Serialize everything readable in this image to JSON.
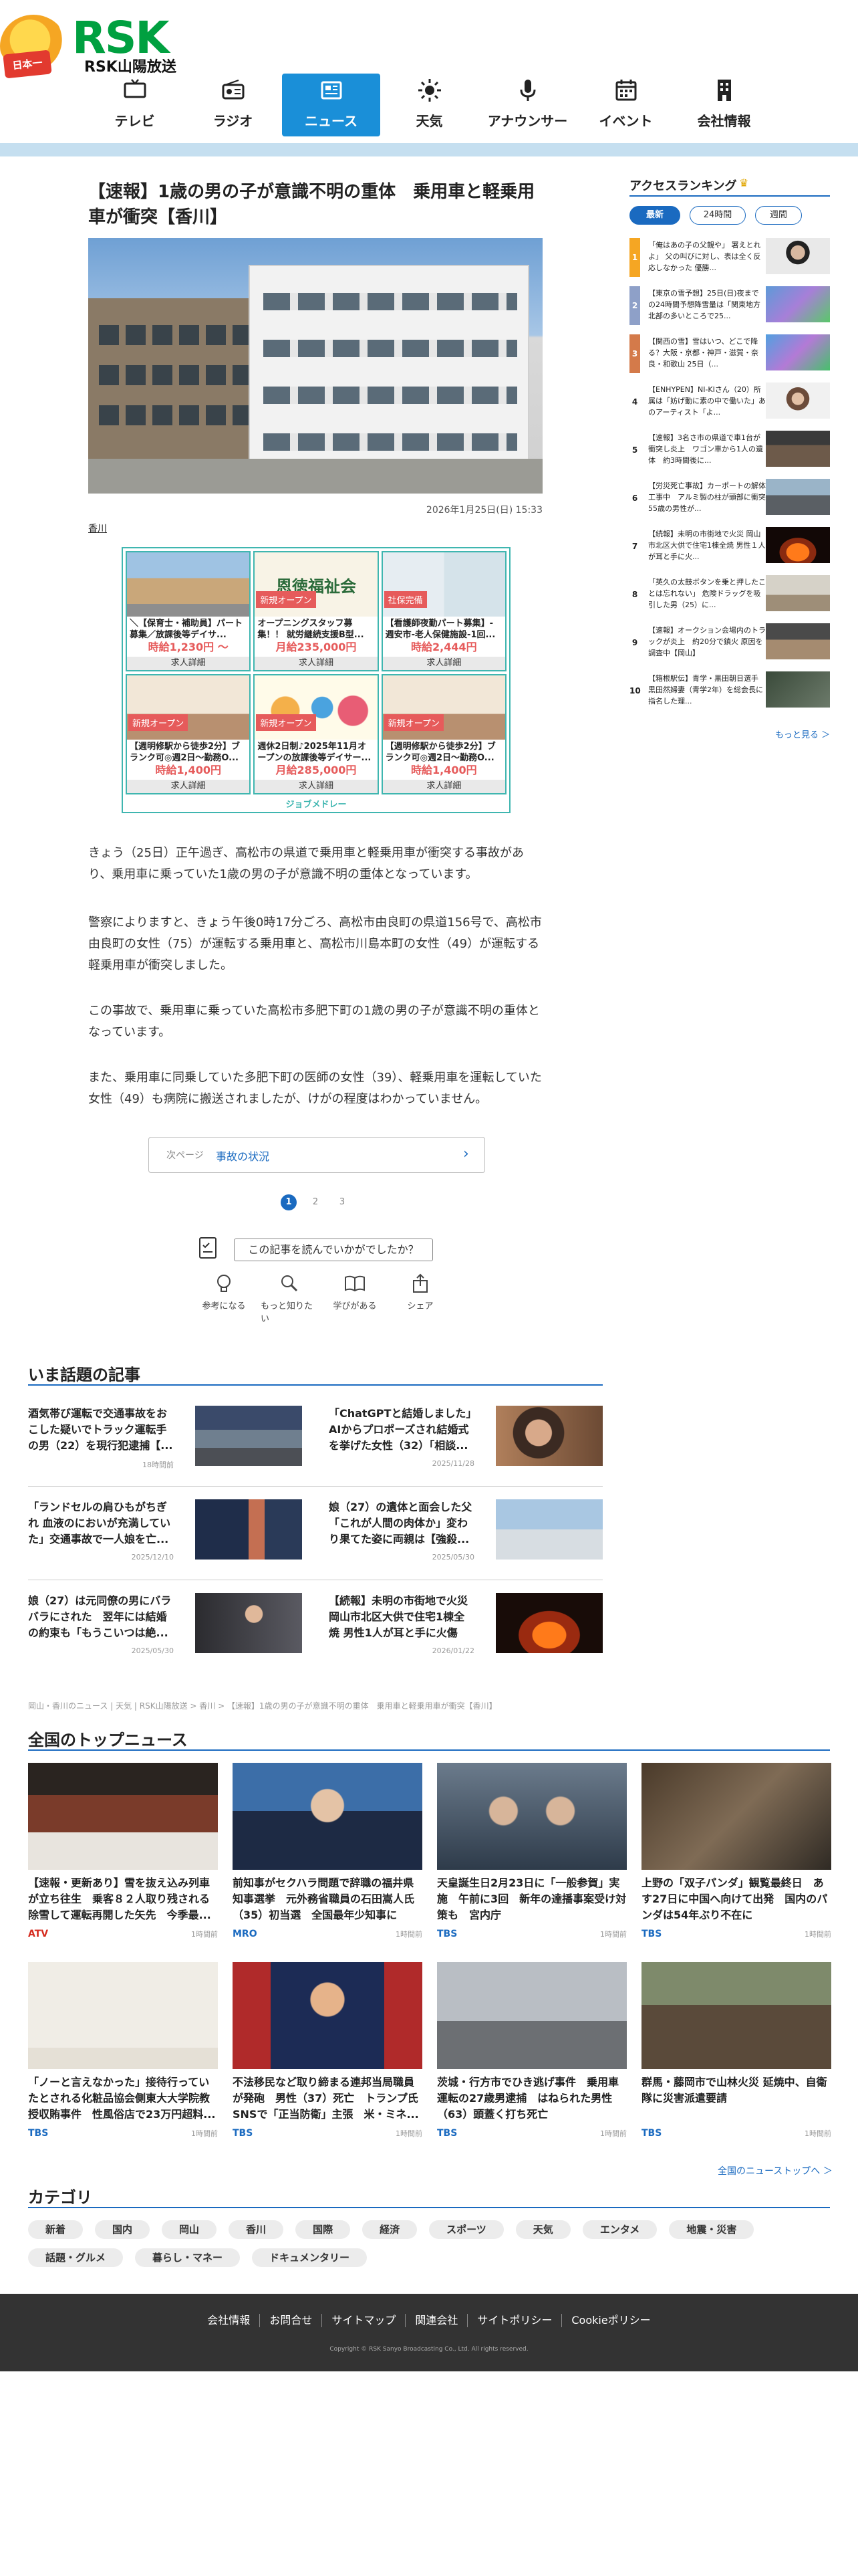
{
  "site": {
    "logo_text": "RSK",
    "logo_sub": "RSK山陽放送",
    "mascot_badge": "日本一"
  },
  "nav": [
    {
      "label": "テレビ",
      "icon": "tv-icon",
      "active": false
    },
    {
      "label": "ラジオ",
      "icon": "radio-icon",
      "active": false
    },
    {
      "label": "ニュース",
      "icon": "news-icon",
      "active": true
    },
    {
      "label": "天気",
      "icon": "sun-icon",
      "active": false
    },
    {
      "label": "アナウンサー",
      "icon": "microphone-icon",
      "active": false
    },
    {
      "label": "イベント",
      "icon": "calendar-icon",
      "active": false
    },
    {
      "label": "会社情報",
      "icon": "building-icon",
      "active": false
    }
  ],
  "article": {
    "title": "【速報】1歳の男の子が意識不明の重体　乗用車と軽乗用車が衝突【香川】",
    "date": "2026年1月25日(日) 15:33",
    "tag": "香川",
    "paragraphs": [
      "きょう（25日）正午過ぎ、高松市の県道で乗用車と軽乗用車が衝突する事故があり、乗用車に乗っていた1歳の男の子が意識不明の重体となっています。",
      "警察によりますと、きょう午後0時17分ごろ、高松市由良町の県道156号で、高松市由良町の女性（75）が運転する乗用車と、高松市川島本町の女性（49）が運転する軽乗用車が衝突しました。",
      "この事故で、乗用車に乗っていた高松市多肥下町の1歳の男の子が意識不明の重体となっています。",
      "また、乗用車に同乗していた多肥下町の医師の女性（39）、軽乗用車を運転していた女性（49）も病院に搬送されましたが、けがの程度はわかっていません。"
    ],
    "next_label": "次ページ",
    "next_title": "事故の状況",
    "pages": [
      "1",
      "2",
      "3"
    ],
    "feedback": "この記事を読んでいかがでしたか？",
    "reactions": [
      {
        "label": "参考になる",
        "icon": "lightbulb-icon"
      },
      {
        "label": "もっと知りたい",
        "icon": "magnifier-icon"
      },
      {
        "label": "学びがある",
        "icon": "book-icon"
      },
      {
        "label": "シェア",
        "icon": "share-icon"
      }
    ]
  },
  "ad": {
    "footer": "ジョブメドレー",
    "cells": [
      {
        "badge": "",
        "text": "＼【保育士・補助員】パート募集／放課後等デイサ...",
        "price": "時給1,230円 〜",
        "detail": "求人詳細"
      },
      {
        "badge": "新規オープン",
        "logo": "恩徳福祉会",
        "text": "オープニングスタッフ募集！！ 就労継続支援B型...",
        "price": "月給235,000円",
        "detail": "求人詳細"
      },
      {
        "badge": "社保完備",
        "text": "【看護師夜勤パート募集】- 週安市-老人保健施設-1回...",
        "price": "時給2,444円",
        "detail": "求人詳細"
      },
      {
        "badge": "新規オープン",
        "text": "【週明修駅から徒歩2分】ブランク可◎週2日〜勤務O...",
        "price": "時給1,400円",
        "detail": "求人詳細"
      },
      {
        "badge": "新規オープン",
        "text": "週休2日制♪2025年11月オープンの放課後等デイサー...",
        "price": "月給285,000円",
        "detail": "求人詳細"
      },
      {
        "badge": "新規オープン",
        "text": "【週明修駅から徒歩2分】ブランク可◎週2日〜勤務O...",
        "price": "時給1,400円",
        "detail": "求人詳細"
      }
    ]
  },
  "trending": {
    "title": "いま話題の記事",
    "items": [
      {
        "text": "酒気帯び運転で交通事故をおこした疑いでトラック運転手の男（22）を現行犯逮捕【...",
        "date": "18時間前"
      },
      {
        "text": "「ChatGPTと結婚しました」AIからプロポーズされ結婚式を挙げた女性（32）「相談...",
        "date": "2025/11/28"
      },
      {
        "text": "「ランドセルの肩ひもがちぎれ 血液のにおいが充満していた」交通事故で一人娘を亡...",
        "date": "2025/12/10"
      },
      {
        "text": "娘（27）の遺体と面会した父「これが人間の肉体か」変わり果てた姿に両親は【強殺...",
        "date": "2025/05/30"
      },
      {
        "text": "娘（27）は元同僚の男にバラバラにされた　翌年には結婚の約束も「もうこいつは絶...",
        "date": "2025/05/30"
      },
      {
        "text": "【続報】未明の市街地で火災 岡山市北区大供で住宅1棟全焼 男性1人が耳と手に火傷【...",
        "date": "2026/01/22"
      }
    ]
  },
  "breadcrumb": "岡山・香川のニュース | 天気 | RSK山陽放送 > 香川 > 【速報】1歳の男の子が意識不明の重体　乗用車と軽乗用車が衝突【香川】",
  "topnews": {
    "title": "全国のトップニュース",
    "more": "全国のニューストップへ ＞",
    "items": [
      {
        "text": "【速報・更新あり】雪を抜え込み列車が立ち往生　乗客８２人取り残される　除雪して運転再開した矢先　今季最...",
        "source": "ATV",
        "time": "1時間前"
      },
      {
        "text": "前知事がセクハラ問題で辞職の福井県知事選挙　元外務省職員の石田嵩人氏（35）初当選　全国最年少知事に",
        "source": "MRO",
        "time": "1時間前"
      },
      {
        "text": "天皇誕生日2月23日に「一般参賀」実施　午前に3回　新年の達播事案受け対策も　宮内庁",
        "source": "TBS",
        "time": "1時間前"
      },
      {
        "text": "上野の「双子パンダ」観覧最終日　あす27日に中国へ向けて出発　国内のパンダは54年ぶり不在に",
        "source": "TBS",
        "time": "1時間前"
      },
      {
        "text": "「ノーと言えなかった」接待行っていたとされる化粧品協会側東大大学院教授収賄事件　性風俗店で23万円超料...",
        "source": "TBS",
        "time": "1時間前"
      },
      {
        "text": "不法移民など取り締まる連邦当局職員が発砲　男性（37）死亡　トランプ氏SNSで「正当防衛」主張　米・ミネ...",
        "source": "TBS",
        "time": "1時間前"
      },
      {
        "text": "茨城・行方市でひき逃げ事件　乗用車運転の27歳男逮捕　はねられた男性（63）頭蓋く打ち死亡",
        "source": "TBS",
        "time": "1時間前"
      },
      {
        "text": "群馬・藤岡市で山林火災 延焼中、自衛隊に災害派遣要請",
        "source": "TBS",
        "time": "1時間前"
      }
    ]
  },
  "categories": {
    "title": "カテゴリ",
    "items": [
      "新着",
      "国内",
      "岡山",
      "香川",
      "国際",
      "経済",
      "スポーツ",
      "天気",
      "エンタメ",
      "地震・災害",
      "話題・グルメ",
      "暮らし・マネー",
      "ドキュメンタリー"
    ]
  },
  "footer": {
    "links": [
      "会社情報",
      "お問合せ",
      "サイトマップ",
      "関連会社",
      "サイトポリシー",
      "Cookieポリシー"
    ],
    "copyright": "Copyright © RSK Sanyo Broadcasting Co., Ltd. All rights reserved."
  },
  "ranking": {
    "title": "アクセスランキング",
    "tabs": [
      "最新",
      "24時間",
      "週間"
    ],
    "more": "もっと見る ＞",
    "items": [
      {
        "num": "1",
        "text": "「俺はあの子の父親や」 署えとれよ」 父の叫びに対し、表は全く反応しなかった 優勝..."
      },
      {
        "num": "2",
        "text": "【東京の雪予想】25日(日)夜までの24時間予想降雪量は「関東地方北部の多いところで25..."
      },
      {
        "num": "3",
        "text": "【関西の雪】雪はいつ、どこで降る？大阪・京都・神戸・滋賀・奈良・和歌山 25日（..."
      },
      {
        "num": "4",
        "text": "【ENHYPEN】NI-KIさん（20）所属は「妨げ動に素の中で働いた」あのアーティスト「よ..."
      },
      {
        "num": "5",
        "text": "【速報】3名さ市の県道で車1台が衝突し炎上　ワゴン車から1人の遺体　約3時間後に..."
      },
      {
        "num": "6",
        "text": "【労災死亡事故】カーポートの解体工事中　アルミ製の柱が頭部に衝突　55歳の男性が..."
      },
      {
        "num": "7",
        "text": "【続報】未明の市街地で火災 岡山市北区大供で住宅1棟全焼 男性１人が耳と手に火..."
      },
      {
        "num": "8",
        "text": "「英久の太鼓ボタンを乗と押したことは忘れない」 危険ドラッグを吸引した男（25）に..."
      },
      {
        "num": "9",
        "text": "【速報】オークション会場内のトラックが炎上　約20分で鎮火 原因を調査中【岡山】"
      },
      {
        "num": "10",
        "text": "【箱根駅伝】青学・黒田朝日選手　黒田然婦妻（青学2年）を総会長に指名した理..."
      }
    ]
  },
  "colors": {
    "brand_green": "#00a040",
    "nav_active": "#1a8fd8",
    "accent_blue": "#1a6ac0",
    "ad_teal": "#3fb6b0"
  }
}
